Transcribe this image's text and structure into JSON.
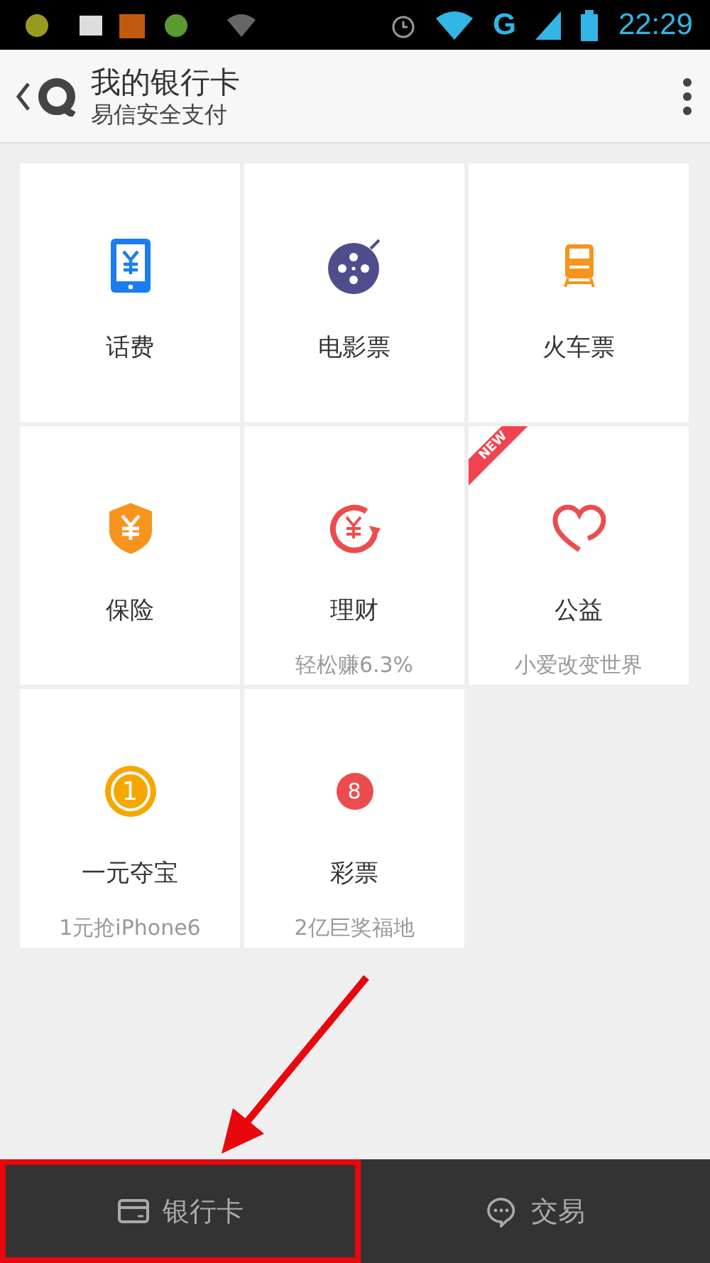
{
  "status_bar": {
    "time": "22:29",
    "network": "G"
  },
  "header": {
    "title": "我的银行卡",
    "subtitle": "易信安全支付"
  },
  "tiles": [
    {
      "kind": "phone",
      "label": "话费"
    },
    {
      "kind": "film",
      "label": "电影票"
    },
    {
      "kind": "train",
      "label": "火车票"
    },
    {
      "kind": "shield",
      "label": "保险"
    },
    {
      "kind": "growth",
      "label": "理财",
      "subtitle": "轻松赚6.3%"
    },
    {
      "kind": "heart",
      "label": "公益",
      "subtitle": "小爱改变世界",
      "badge": "NEW"
    },
    {
      "kind": "coin",
      "label": "一元夺宝",
      "subtitle": "1元抢iPhone6",
      "glyph": "1"
    },
    {
      "kind": "lottery",
      "label": "彩票",
      "subtitle": "2亿巨奖福地",
      "glyph": "8"
    }
  ],
  "bottom_tabs": [
    {
      "kind": "card",
      "label": "银行卡",
      "highlighted": true
    },
    {
      "kind": "chat",
      "label": "交易",
      "highlighted": false
    }
  ]
}
